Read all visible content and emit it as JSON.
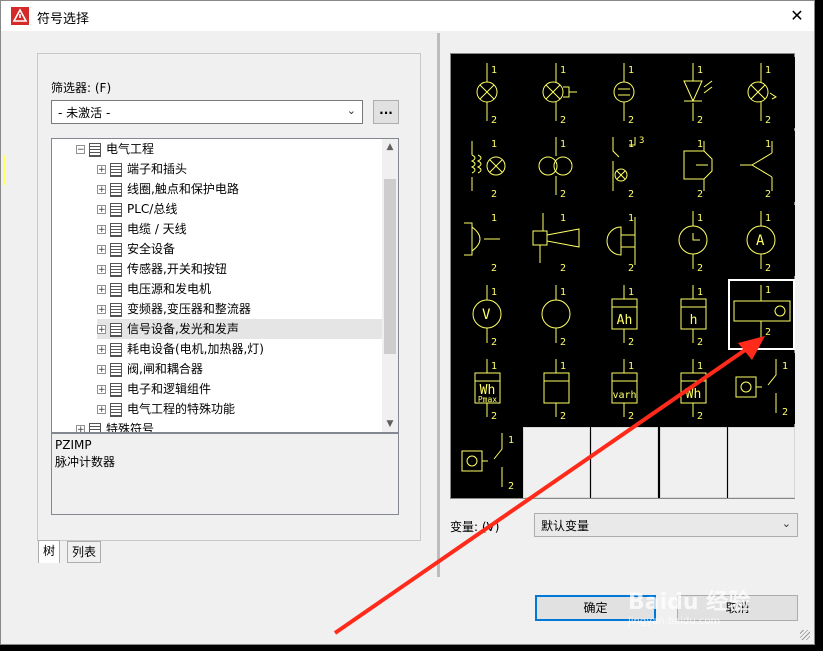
{
  "window": {
    "title": "符号选择",
    "close_glyph": "✕"
  },
  "filter": {
    "label": "筛选器: (F)",
    "value": "- 未激活 -",
    "more_button": "..."
  },
  "tree": {
    "items": [
      {
        "label": "电气工程",
        "level": 1,
        "expander": "−"
      },
      {
        "label": "端子和插头",
        "level": 2,
        "expander": "+"
      },
      {
        "label": "线圈,触点和保护电路",
        "level": 2,
        "expander": "+"
      },
      {
        "label": "PLC/总线",
        "level": 2,
        "expander": "+"
      },
      {
        "label": "电缆 / 天线",
        "level": 2,
        "expander": "+"
      },
      {
        "label": "安全设备",
        "level": 2,
        "expander": "+"
      },
      {
        "label": "传感器,开关和按钮",
        "level": 2,
        "expander": "+"
      },
      {
        "label": "电压源和发电机",
        "level": 2,
        "expander": "+"
      },
      {
        "label": "变频器,变压器和整流器",
        "level": 2,
        "expander": "+"
      },
      {
        "label": "信号设备,发光和发声",
        "level": 2,
        "expander": "+",
        "selected": true
      },
      {
        "label": "耗电设备(电机,加热器,灯)",
        "level": 2,
        "expander": "+"
      },
      {
        "label": "阀,闸和耦合器",
        "level": 2,
        "expander": "+"
      },
      {
        "label": "电子和逻辑组件",
        "level": 2,
        "expander": "+"
      },
      {
        "label": "电气工程的特殊功能",
        "level": 2,
        "expander": "+"
      },
      {
        "label": "特殊符号",
        "level": 1,
        "expander": "+"
      }
    ]
  },
  "description": {
    "code": "PZIMP",
    "text": "脉冲计数器"
  },
  "tabs": [
    {
      "label": "树",
      "active": true
    },
    {
      "label": "列表",
      "active": false
    }
  ],
  "symbols": {
    "columns": 5,
    "selected_index": 19,
    "cells": [
      {
        "kind": "lamp",
        "top": "1",
        "bottom": "2",
        "text": ""
      },
      {
        "kind": "lamp-plug",
        "top": "1",
        "bottom": "2",
        "text": ""
      },
      {
        "kind": "glow-lamp",
        "top": "1",
        "bottom": "2",
        "text": ""
      },
      {
        "kind": "led",
        "top": "1",
        "bottom": "2",
        "text": ""
      },
      {
        "kind": "lamp-flash",
        "top": "1",
        "bottom": "2",
        "text": ""
      },
      {
        "kind": "transformer-lamp",
        "top": "1",
        "bottom": "2",
        "text": ""
      },
      {
        "kind": "double-lamp",
        "top": "1",
        "bottom": "2",
        "text": ""
      },
      {
        "kind": "switch-lamp",
        "top": "1",
        "bottom": "2",
        "text": "3"
      },
      {
        "kind": "bell",
        "top": "1",
        "bottom": "2",
        "text": ""
      },
      {
        "kind": "buzzer",
        "top": "1",
        "bottom": "2",
        "text": ""
      },
      {
        "kind": "horn",
        "top": "1",
        "bottom": "2",
        "text": ""
      },
      {
        "kind": "siren",
        "top": "1",
        "bottom": "2",
        "text": ""
      },
      {
        "kind": "half-circle",
        "top": "1",
        "bottom": "2",
        "text": ""
      },
      {
        "kind": "clock",
        "top": "1",
        "bottom": "2",
        "text": ""
      },
      {
        "kind": "meter",
        "top": "1",
        "bottom": "2",
        "text": "A"
      },
      {
        "kind": "meter",
        "top": "1",
        "bottom": "2",
        "text": "V"
      },
      {
        "kind": "circle",
        "top": "1",
        "bottom": "2",
        "text": ""
      },
      {
        "kind": "box",
        "top": "1",
        "bottom": "2",
        "text": "Ah"
      },
      {
        "kind": "box",
        "top": "1",
        "bottom": "2",
        "text": "h"
      },
      {
        "kind": "pulse-counter",
        "top": "1",
        "bottom": "2",
        "text": ""
      },
      {
        "kind": "box",
        "top": "1",
        "bottom": "2",
        "text": "Wh",
        "text2": "Pmax"
      },
      {
        "kind": "box",
        "top": "1",
        "bottom": "2",
        "text": ""
      },
      {
        "kind": "box",
        "top": "1",
        "bottom": "2",
        "text": "varh"
      },
      {
        "kind": "box",
        "top": "1",
        "bottom": "2",
        "text": "Wh"
      },
      {
        "kind": "counter-switch",
        "top": "1",
        "bottom": "2",
        "text": ""
      },
      {
        "kind": "counter-switch",
        "top": "1",
        "bottom": "2",
        "text": ""
      },
      {
        "kind": "empty"
      },
      {
        "kind": "empty"
      },
      {
        "kind": "empty"
      },
      {
        "kind": "empty"
      }
    ]
  },
  "variant": {
    "label": "变量: (V)",
    "value": "默认变量"
  },
  "buttons": {
    "ok": "确定",
    "cancel": "取消"
  },
  "colors": {
    "symbol_bg": "#000000",
    "symbol_line": "#ffff66",
    "annotation_arrow": "#ff2a1a",
    "accent": "#0078d7"
  },
  "watermark": {
    "line1": "Baidu 经验",
    "line2": "jingyan.baidu.com"
  }
}
